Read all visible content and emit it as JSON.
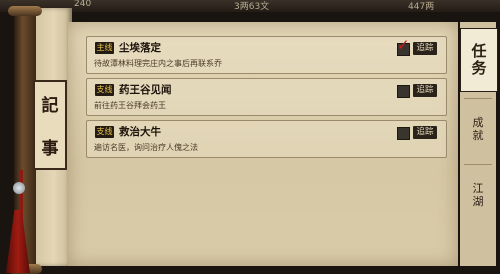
{
  "top_bar": {
    "left_value": "240",
    "center_value": "3两63文",
    "right_value": "447两"
  },
  "title": {
    "char1": "記",
    "char2": "事"
  },
  "quests": [
    {
      "tag": "主线",
      "title": "尘埃落定",
      "desc": "待故潭林料理完庄内之事后再联系乔",
      "tracked": true,
      "track_label": "追踪"
    },
    {
      "tag": "支线",
      "title": "药王谷见闻",
      "desc": "前往药王谷拜会药王",
      "tracked": false,
      "track_label": "追踪"
    },
    {
      "tag": "支线",
      "title": "救治大牛",
      "desc": "遍访名医，询问治疗人傀之法",
      "tracked": false,
      "track_label": "追踪"
    }
  ],
  "tabs": [
    {
      "label": "任务",
      "chars": [
        "任",
        "务"
      ],
      "active": true
    },
    {
      "label": "成就",
      "chars": [
        "成",
        "就"
      ],
      "active": false
    },
    {
      "label": "江湖",
      "chars": [
        "江",
        "湖"
      ],
      "active": false
    }
  ],
  "colors": {
    "tag_text": "#e7c24a",
    "check_mark": "#c02018",
    "panel_bg": "#e2d6b6"
  }
}
